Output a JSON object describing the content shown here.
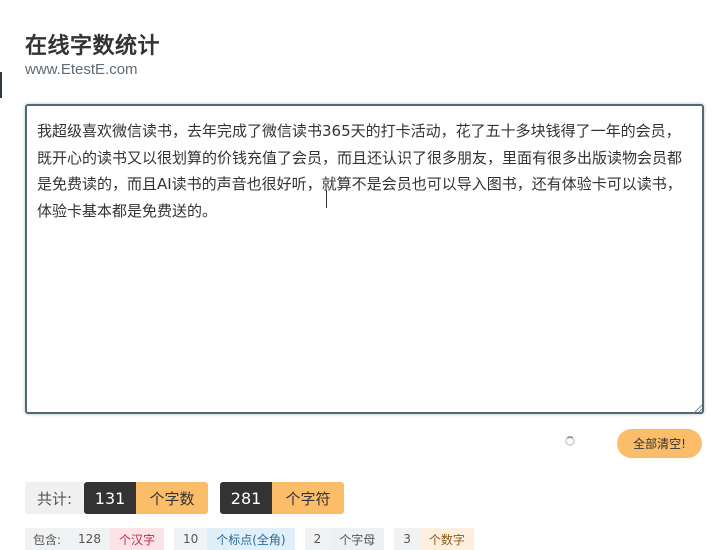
{
  "header": {
    "title": "在线字数统计",
    "subtitle": "www.EtestE.com"
  },
  "editor": {
    "text": "我超级喜欢微信读书，去年完成了微信读书365天的打卡活动，花了五十多块钱得了一年的会员，既开心的读书又以很划算的价钱充值了会员，而且还认识了很多朋友，里面有很多出版读物会员都是免费读的，而且AI读书的声音也很好听，就算不是会员也可以导入图书，还有体验卡可以读书，体验卡基本都是免费送的。"
  },
  "actions": {
    "clear_label": "全部清空!"
  },
  "totals": {
    "label": "共计:",
    "words_value": "131",
    "words_unit": "个字数",
    "chars_value": "281",
    "chars_unit": "个字符"
  },
  "breakdown": {
    "label": "包含:",
    "items": [
      {
        "value": "128",
        "unit": "个汉字"
      },
      {
        "value": "10",
        "unit": "个标点(全角)"
      },
      {
        "value": "2",
        "unit": "个字母"
      },
      {
        "value": "3",
        "unit": "个数字"
      }
    ]
  },
  "colors": {
    "accent": "#fbbd6a",
    "dark": "#333333",
    "textarea_border": "#4f6a74"
  }
}
